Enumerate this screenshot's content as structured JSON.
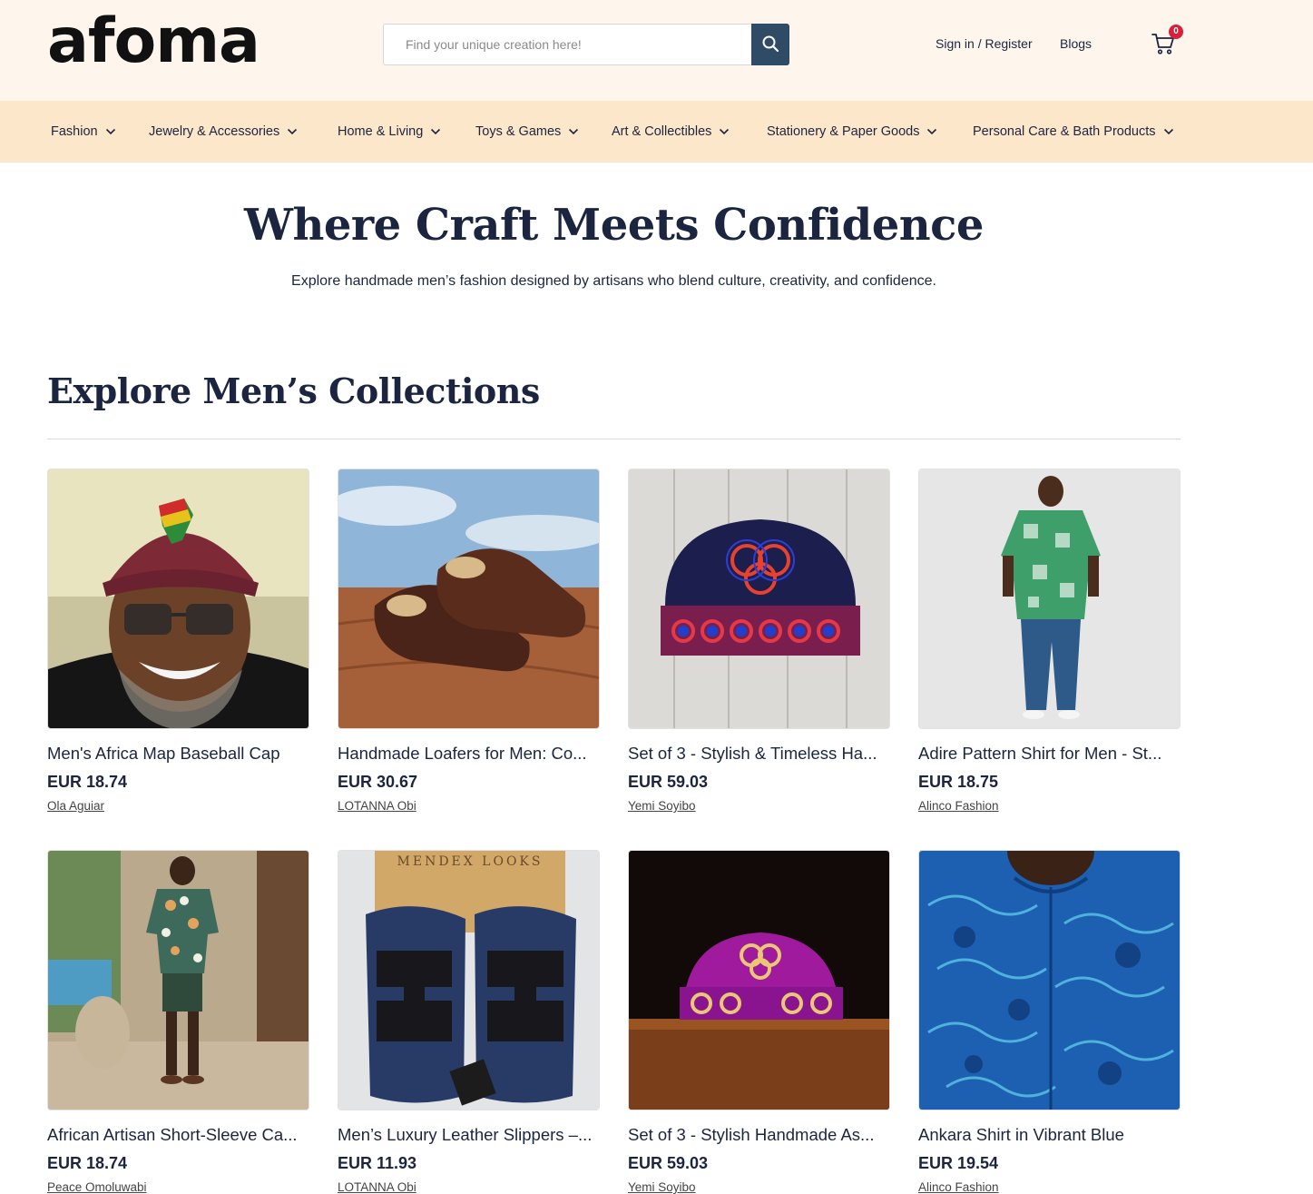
{
  "header": {
    "logo": "afoma",
    "search_placeholder": "Find your unique creation here!",
    "sign_in_label": "Sign in / Register",
    "blogs_label": "Blogs",
    "cart_count": "0"
  },
  "nav": {
    "items": [
      {
        "label": "Fashion"
      },
      {
        "label": "Jewelry & Accessories"
      },
      {
        "label": "Home & Living"
      },
      {
        "label": "Toys & Games"
      },
      {
        "label": "Art & Collectibles"
      },
      {
        "label": "Stationery & Paper Goods"
      },
      {
        "label": "Personal Care & Bath Products"
      }
    ]
  },
  "hero": {
    "title": "Where Craft Meets Confidence",
    "subtitle": "Explore handmade men’s fashion designed by artisans who blend culture, creativity, and confidence."
  },
  "section": {
    "title": "Explore Men’s Collections"
  },
  "products": [
    {
      "title": "Men's Africa Map Baseball Cap",
      "price": "EUR 18.74",
      "seller": "Ola Aguiar"
    },
    {
      "title": "Handmade Loafers for Men: Co...",
      "price": "EUR 30.67",
      "seller": "LOTANNA Obi"
    },
    {
      "title": "Set of 3 - Stylish & Timeless Ha...",
      "price": "EUR 59.03",
      "seller": "Yemi Soyibo"
    },
    {
      "title": "Adire Pattern Shirt for Men - St...",
      "price": "EUR 18.75",
      "seller": "Alinco Fashion"
    },
    {
      "title": "African Artisan Short-Sleeve Ca...",
      "price": "EUR 18.74",
      "seller": "Peace Omoluwabi"
    },
    {
      "title": "Men’s Luxury Leather Slippers –...",
      "price": "EUR 11.93",
      "seller": "LOTANNA Obi"
    },
    {
      "title": "Set of 3 - Stylish Handmade As...",
      "price": "EUR 59.03",
      "seller": "Yemi Soyibo"
    },
    {
      "title": "Ankara Shirt in Vibrant Blue",
      "price": "EUR 19.54",
      "seller": "Alinco Fashion"
    }
  ],
  "image_text": {
    "slipper_box_brand": "MENDEX LOOKS"
  },
  "colors": {
    "header_bg": "#fef6ec",
    "nav_bg": "#fde7cb",
    "search_button": "#2f4b66",
    "text_navy": "#1b2540",
    "cart_badge": "#d8203a"
  },
  "icons": {
    "search": "search-icon",
    "cart": "cart-icon",
    "chevron": "chevron-down-icon"
  }
}
